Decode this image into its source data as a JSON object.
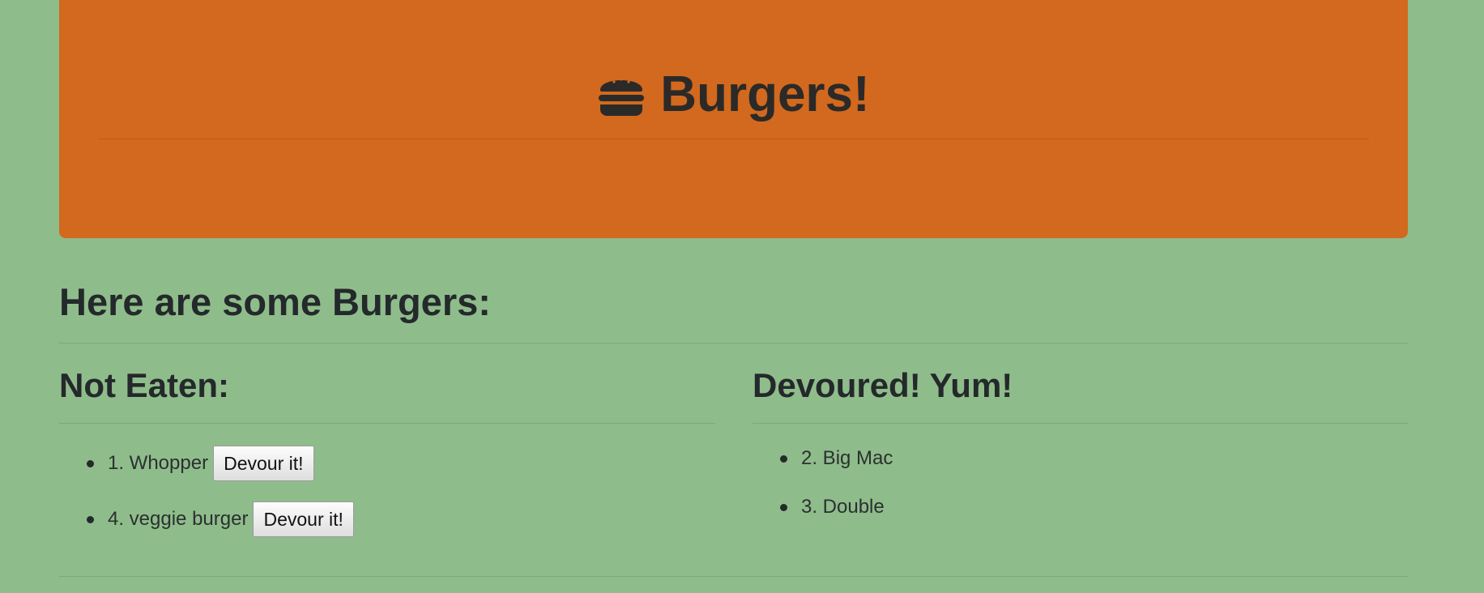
{
  "header": {
    "title": "Burgers!",
    "icon": "hamburger-icon"
  },
  "main": {
    "heading": "Here are some Burgers:"
  },
  "not_eaten": {
    "heading": "Not Eaten:",
    "items": [
      {
        "label": "1. Whopper",
        "button_label": "Devour it!"
      },
      {
        "label": "4. veggie burger",
        "button_label": "Devour it!"
      }
    ]
  },
  "devoured": {
    "heading": "Devoured! Yum!",
    "items": [
      {
        "label": "2. Big Mac"
      },
      {
        "label": "3. Double"
      }
    ]
  },
  "colors": {
    "page_background": "#8fbc8b",
    "jumbotron_background": "#d2691e",
    "text": "#24292b"
  }
}
